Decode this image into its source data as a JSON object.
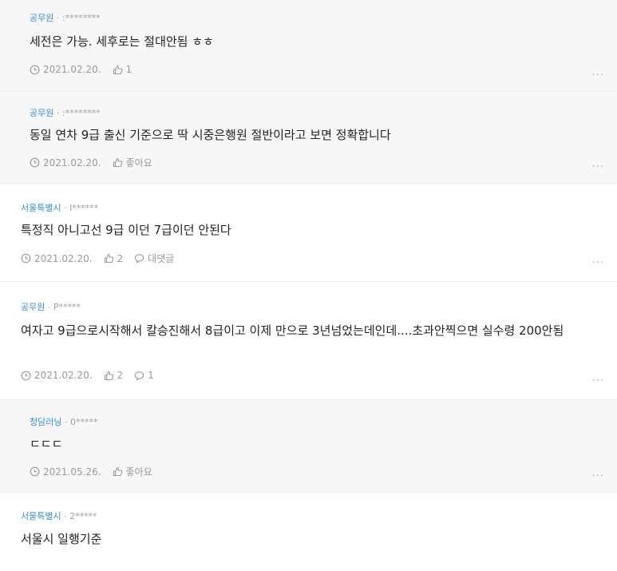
{
  "comments": [
    {
      "author": "공무원",
      "uid": ":********",
      "text": "세전은 가능. 세후로는 절대안됨 ㅎㅎ",
      "date": "2021.02.20.",
      "likes": "1",
      "replies": null,
      "more": "..."
    },
    {
      "author": "공무원",
      "uid": ":********",
      "text": "동일 연차 9급 출신 기준으로 딱 시중은행원 절반이라고 보면 정확합니다",
      "date": "2021.02.20.",
      "likes": "좋아요",
      "replies": null,
      "more": "..."
    },
    {
      "author": "서울특별시",
      "uid": "l******",
      "text": "특정직 아니고선 9급 이던 7급이던 안된다",
      "date": "2021.02.20.",
      "likes": "2",
      "replies": "대댓글",
      "more": "..."
    },
    {
      "author": "공무원",
      "uid": "P*****",
      "text": "여자고 9급으로시작해서 칼승진해서 8급이고 이제 만으로 3년넘었는데인데....초과안찍으면 실수령 200안됨",
      "date": "2021.02.20.",
      "likes": "2",
      "replies": "1",
      "more": "..."
    },
    {
      "author": "청담러닝",
      "uid": "0*****",
      "text": "ㄷㄷㄷ",
      "date": "2021.05.26.",
      "likes": "좋아요",
      "replies": null,
      "more": "..."
    },
    {
      "author": "서울특별시",
      "uid": "2*****",
      "text": "서울시 일행기준"
    }
  ],
  "separator": "·",
  "colors": {
    "author": "#3a8fd0",
    "reply_bg": "#f7f7f8",
    "meta": "#9a9a9a"
  },
  "icons": {
    "date": "clock-icon",
    "like": "thumbs-up-icon",
    "reply": "speech-bubble-icon",
    "more": "more-dots-icon"
  }
}
